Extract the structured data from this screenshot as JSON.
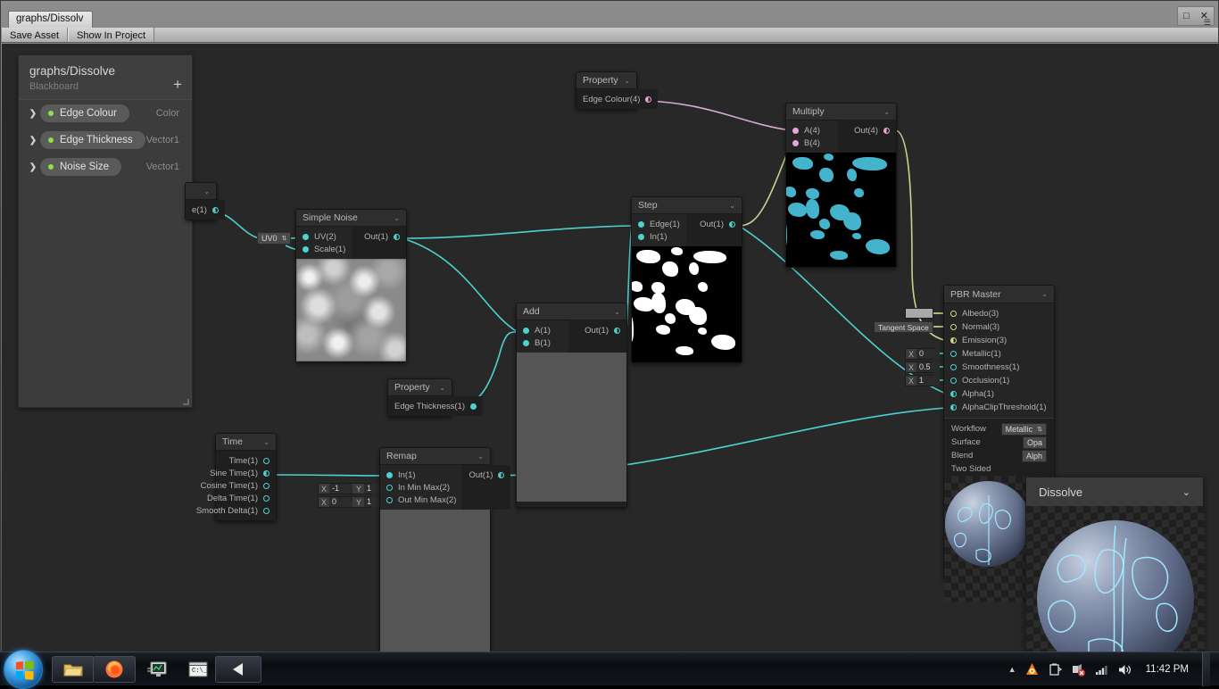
{
  "window": {
    "tab_title": "graphs/Dissolv",
    "controls": {
      "maximize": "□",
      "close": "✕",
      "menu": "☰"
    }
  },
  "toolbar": {
    "buttons": [
      "Save Asset",
      "Show In Project"
    ]
  },
  "blackboard": {
    "title": "graphs/Dissolve",
    "subtitle": "Blackboard",
    "add_label": "+",
    "properties": [
      {
        "name": "Edge Colour",
        "type": "Color",
        "expand": "❯"
      },
      {
        "name": "Edge Thickness",
        "type": "Vector1",
        "expand": "❯"
      },
      {
        "name": "Noise Size",
        "type": "Vector1",
        "expand": "❯"
      }
    ]
  },
  "nodes": {
    "hidden_left": {
      "title": "",
      "chevron": "⌄",
      "out": "e(1)"
    },
    "uv_dropdown": {
      "value": "UV0",
      "arrow": "⇅"
    },
    "simple_noise": {
      "title": "Simple Noise",
      "chevron": "⌄",
      "inputs": [
        "UV(2)",
        "Scale(1)"
      ],
      "outputs": [
        "Out(1)"
      ]
    },
    "step": {
      "title": "Step",
      "chevron": "⌄",
      "inputs": [
        "Edge(1)",
        "In(1)"
      ],
      "outputs": [
        "Out(1)"
      ]
    },
    "multiply": {
      "title": "Multiply",
      "chevron": "⌄",
      "inputs": [
        "A(4)",
        "B(4)"
      ],
      "outputs": [
        "Out(4)"
      ]
    },
    "add": {
      "title": "Add",
      "chevron": "⌄",
      "inputs": [
        "A(1)",
        "B(1)"
      ],
      "outputs": [
        "Out(1)"
      ]
    },
    "property_edge_colour": {
      "title": "Property",
      "chevron": "⌄",
      "output": "Edge Colour(4)"
    },
    "property_edge_thickness": {
      "title": "Property",
      "chevron": "⌄",
      "output": "Edge Thickness(1)"
    },
    "time": {
      "title": "Time",
      "chevron": "⌄",
      "outputs": [
        "Time(1)",
        "Sine Time(1)",
        "Cosine Time(1)",
        "Delta Time(1)",
        "Smooth Delta(1)"
      ]
    },
    "remap": {
      "title": "Remap",
      "chevron": "⌄",
      "inputs": [
        "In(1)",
        "In Min Max(2)",
        "Out Min Max(2)"
      ],
      "outputs": [
        "Out(1)"
      ],
      "in_min_max": {
        "x_label": "X",
        "x": "-1",
        "y_label": "Y",
        "y": "1"
      },
      "out_min_max": {
        "x_label": "X",
        "x": "0",
        "y_label": "Y",
        "y": "1"
      }
    },
    "pbr_master": {
      "title": "PBR Master",
      "chevron": "⌄",
      "slots": [
        "Albedo(3)",
        "Normal(3)",
        "Emission(3)",
        "Metallic(1)",
        "Smoothness(1)",
        "Occlusion(1)",
        "Alpha(1)",
        "AlphaClipThreshold(1)"
      ],
      "inline_controls": {
        "albedo_swatch": "",
        "normal_space": "Tangent Space",
        "metallic": {
          "label": "X",
          "value": "0"
        },
        "smoothness": {
          "label": "X",
          "value": "0.5"
        },
        "occlusion": {
          "label": "X",
          "value": "1"
        }
      },
      "settings": [
        {
          "label": "Workflow",
          "value": "Metallic",
          "arrow": "⇅"
        },
        {
          "label": "Surface",
          "value": "Opa",
          "arrow": ""
        },
        {
          "label": "Blend",
          "value": "Alph",
          "arrow": ""
        },
        {
          "label": "Two Sided",
          "value": "",
          "arrow": ""
        }
      ]
    }
  },
  "dissolve_preview": {
    "title": "Dissolve",
    "chevron": "⌄"
  },
  "colors": {
    "port_cyan": "#4dd2d2",
    "port_pink": "#e8a5d8",
    "port_yellow": "#d9d98a",
    "property_dot_green": "#8ee04a",
    "wire_cyan": "#4dd2d2",
    "wire_pink": "#d9a8cf",
    "wire_yellow": "#cfcf8e",
    "canvas_bg": "#282828",
    "node_bg": "#1f1f1f",
    "blob_cyan": "#44b3cc"
  },
  "taskbar": {
    "start_label": "Start",
    "items": [
      {
        "name": "file-explorer-icon",
        "glyph": ""
      },
      {
        "name": "firefox-icon",
        "glyph": ""
      },
      {
        "name": "monitor-icon",
        "glyph": ""
      },
      {
        "name": "command-prompt-icon",
        "glyph": "C:\\_"
      },
      {
        "name": "unity-icon",
        "glyph": ""
      }
    ],
    "tray": {
      "overflow_arrow": "▲",
      "icons": [
        "avast-icon",
        "battery-icon",
        "network-disconnected-icon",
        "signal-icon",
        "volume-icon"
      ],
      "clock": "11:42 PM"
    }
  }
}
